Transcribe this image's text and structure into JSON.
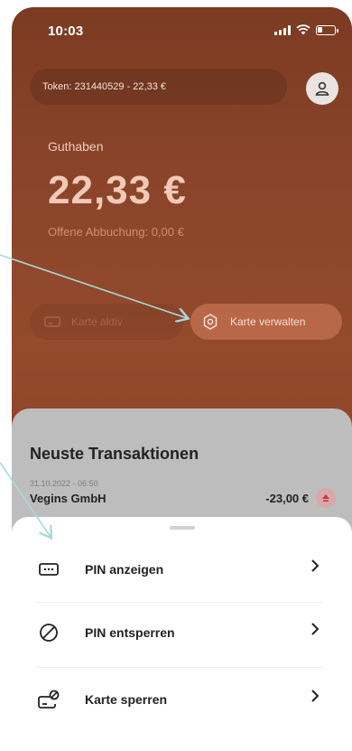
{
  "status": {
    "time": "10:03"
  },
  "header": {
    "token_text": "Token: 231440529 - 22,33 €"
  },
  "balance": {
    "label": "Guthaben",
    "amount": "22,33 €",
    "pending": "Offene Abbuchung: 0,00 €"
  },
  "actions": {
    "card_active_label": "Karte aktiv",
    "manage_label": "Karte verwalten"
  },
  "transactions": {
    "title": "Neuste Transaktionen",
    "items": [
      {
        "date": "31.10.2022 - 06:50",
        "merchant": "Vegins GmbH",
        "amount": "-23,00 €"
      }
    ]
  },
  "sheet": {
    "items": [
      {
        "label": "PIN anzeigen",
        "icon": "pin-card-icon"
      },
      {
        "label": "PIN entsperren",
        "icon": "blocked-circle-icon"
      },
      {
        "label": "Karte sperren",
        "icon": "card-lock-icon"
      }
    ]
  },
  "colors": {
    "header_bg": "#8a4429",
    "accent_button": "#b86748",
    "annotation_arrow": "#a8dada"
  }
}
